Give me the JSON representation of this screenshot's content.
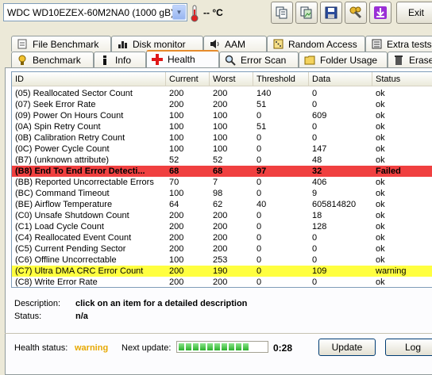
{
  "toolbar": {
    "drive": "WDC WD10EZEX-60M2NA0 (1000 gB)",
    "temperature": "-- °C",
    "exit_label": "Exit"
  },
  "tabs_top": [
    {
      "label": "File Benchmark",
      "icon": "file-benchmark-icon"
    },
    {
      "label": "Disk monitor",
      "icon": "disk-monitor-icon"
    },
    {
      "label": "AAM",
      "icon": "speaker-icon"
    },
    {
      "label": "Random Access",
      "icon": "random-access-icon"
    },
    {
      "label": "Extra tests",
      "icon": "extra-tests-icon"
    }
  ],
  "tabs_bottom": [
    {
      "label": "Benchmark",
      "icon": "benchmark-icon"
    },
    {
      "label": "Info",
      "icon": "info-icon"
    },
    {
      "label": "Health",
      "icon": "health-cross-icon",
      "active": true
    },
    {
      "label": "Error Scan",
      "icon": "magnifier-icon"
    },
    {
      "label": "Folder Usage",
      "icon": "folder-icon"
    },
    {
      "label": "Erase",
      "icon": "trash-icon"
    }
  ],
  "table": {
    "columns": [
      "ID",
      "Current",
      "Worst",
      "Threshold",
      "Data",
      "Status"
    ],
    "rows": [
      {
        "id": "(05) Reallocated Sector Count",
        "current": "200",
        "worst": "200",
        "threshold": "140",
        "data": "0",
        "status": "ok"
      },
      {
        "id": "(07) Seek Error Rate",
        "current": "200",
        "worst": "200",
        "threshold": "51",
        "data": "0",
        "status": "ok"
      },
      {
        "id": "(09) Power On Hours Count",
        "current": "100",
        "worst": "100",
        "threshold": "0",
        "data": "609",
        "status": "ok"
      },
      {
        "id": "(0A) Spin Retry Count",
        "current": "100",
        "worst": "100",
        "threshold": "51",
        "data": "0",
        "status": "ok"
      },
      {
        "id": "(0B) Calibration Retry Count",
        "current": "100",
        "worst": "100",
        "threshold": "0",
        "data": "0",
        "status": "ok"
      },
      {
        "id": "(0C) Power Cycle Count",
        "current": "100",
        "worst": "100",
        "threshold": "0",
        "data": "147",
        "status": "ok"
      },
      {
        "id": "(B7) (unknown attribute)",
        "current": "52",
        "worst": "52",
        "threshold": "0",
        "data": "48",
        "status": "ok"
      },
      {
        "id": "(B8) End To End Error Detecti...",
        "current": "68",
        "worst": "68",
        "threshold": "97",
        "data": "32",
        "status": "Failed",
        "state": "failed"
      },
      {
        "id": "(BB) Reported Uncorrectable Errors",
        "current": "70",
        "worst": "7",
        "threshold": "0",
        "data": "406",
        "status": "ok"
      },
      {
        "id": "(BC) Command Timeout",
        "current": "100",
        "worst": "98",
        "threshold": "0",
        "data": "9",
        "status": "ok"
      },
      {
        "id": "(BE) Airflow Temperature",
        "current": "64",
        "worst": "62",
        "threshold": "40",
        "data": "605814820",
        "status": "ok"
      },
      {
        "id": "(C0) Unsafe Shutdown Count",
        "current": "200",
        "worst": "200",
        "threshold": "0",
        "data": "18",
        "status": "ok"
      },
      {
        "id": "(C1) Load Cycle Count",
        "current": "200",
        "worst": "200",
        "threshold": "0",
        "data": "128",
        "status": "ok"
      },
      {
        "id": "(C4) Reallocated Event Count",
        "current": "200",
        "worst": "200",
        "threshold": "0",
        "data": "0",
        "status": "ok"
      },
      {
        "id": "(C5) Current Pending Sector",
        "current": "200",
        "worst": "200",
        "threshold": "0",
        "data": "0",
        "status": "ok"
      },
      {
        "id": "(C6) Offline Uncorrectable",
        "current": "100",
        "worst": "253",
        "threshold": "0",
        "data": "0",
        "status": "ok"
      },
      {
        "id": "(C7) Ultra DMA CRC Error Count",
        "current": "200",
        "worst": "190",
        "threshold": "0",
        "data": "109",
        "status": "warning",
        "state": "warning"
      },
      {
        "id": "(C8) Write Error Rate",
        "current": "200",
        "worst": "200",
        "threshold": "0",
        "data": "0",
        "status": "ok"
      }
    ]
  },
  "description": {
    "label": "Description:",
    "value": "click on an item for a detailed description",
    "status_label": "Status:",
    "status_value": "n/a"
  },
  "footer": {
    "health_label": "Health status:",
    "health_value": "warning",
    "next_update_label": "Next update:",
    "progress_fraction": 0.85,
    "time_left": "0:28",
    "update_label": "Update",
    "log_label": "Log"
  },
  "colors": {
    "failed_row": "#F04040",
    "warning_row": "#FFFF40",
    "warning_text": "#E6A800"
  }
}
